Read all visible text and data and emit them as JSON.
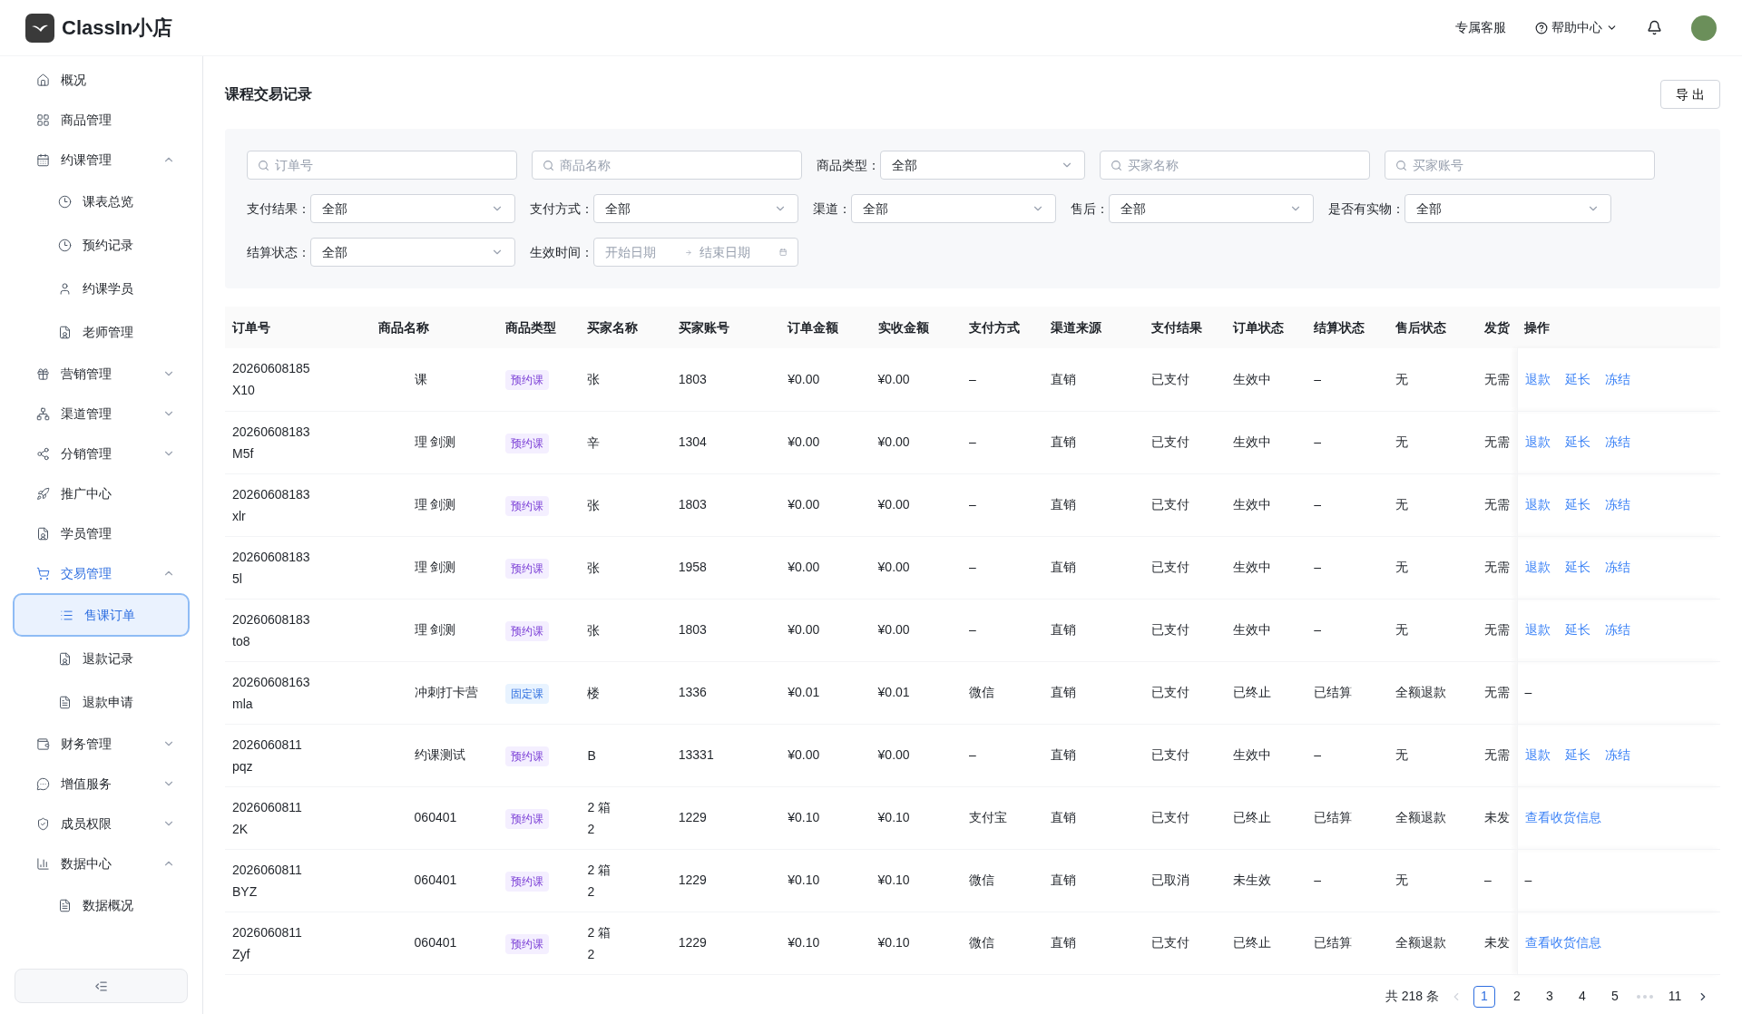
{
  "header": {
    "logo_text": "ClassIn小店",
    "links": [
      "专属客服",
      "帮助中心"
    ]
  },
  "sidebar": {
    "items": [
      {
        "label": "概况"
      },
      {
        "label": "商品管理"
      },
      {
        "label": "约课管理",
        "expanded": true,
        "children": [
          {
            "label": "课表总览",
            "selected": false
          },
          {
            "label": "预约记录",
            "selected": false
          },
          {
            "label": "约课学员",
            "selected": false
          },
          {
            "label": "老师管理",
            "selected": false
          }
        ]
      },
      {
        "label": "营销管理",
        "expanded": false
      },
      {
        "label": "渠道管理",
        "expanded": false
      },
      {
        "label": "分销管理",
        "expanded": false
      },
      {
        "label": "推广中心"
      },
      {
        "label": "学员管理"
      },
      {
        "label": "交易管理",
        "expanded": true,
        "active": true,
        "children": [
          {
            "label": "售课订单",
            "selected": true
          },
          {
            "label": "退款记录",
            "selected": false
          },
          {
            "label": "退款申请",
            "selected": false
          }
        ]
      },
      {
        "label": "财务管理",
        "expanded": false
      },
      {
        "label": "增值服务",
        "expanded": false
      },
      {
        "label": "成员权限",
        "expanded": false
      },
      {
        "label": "数据中心",
        "expanded": true,
        "children": [
          {
            "label": "数据概况",
            "selected": false
          }
        ]
      }
    ]
  },
  "page": {
    "title": "课程交易记录",
    "export_button": "导 出"
  },
  "filters": {
    "search_fields": [
      {
        "placeholder": "订单号"
      },
      {
        "placeholder": "商品名称"
      },
      {
        "placeholder": "买家名称"
      },
      {
        "placeholder": "买家账号"
      }
    ],
    "product_type": {
      "label": "商品类型：",
      "value": "全部"
    },
    "selects": [
      {
        "label": "支付结果：",
        "value": "全部"
      },
      {
        "label": "支付方式：",
        "value": "全部"
      },
      {
        "label": "渠道：",
        "value": "全部"
      },
      {
        "label": "售后：",
        "value": "全部"
      },
      {
        "label": "是否有实物：",
        "value": "全部"
      }
    ],
    "settlement": {
      "label": "结算状态：",
      "value": "全部"
    },
    "date_range": {
      "label": "生效时间：",
      "start_placeholder": "开始日期",
      "end_placeholder": "结束日期"
    }
  },
  "table": {
    "columns": [
      "订单号",
      "商品名称",
      "商品类型",
      "买家名称",
      "买家账号",
      "订单金额",
      "实收金额",
      "支付方式",
      "渠道来源",
      "支付结果",
      "订单状态",
      "结算状态",
      "售后状态",
      "发货",
      "操作"
    ],
    "rows": [
      {
        "order": [
          "20260608185",
          "X10"
        ],
        "product": "课",
        "type": {
          "label": "预约课",
          "kind": "booking"
        },
        "buyer": [
          "张"
        ],
        "account": "1803",
        "amount": "¥0.00",
        "received": "¥0.00",
        "pay_method": "–",
        "channel": "直销",
        "pay_result": "已支付",
        "status": "生效中",
        "settle": "–",
        "after_sale": "无",
        "ship": "无需",
        "actions": [
          "退款",
          "延长",
          "冻结"
        ]
      },
      {
        "order": [
          "20260608183",
          "M5f"
        ],
        "product": "理 剑测",
        "type": {
          "label": "预约课",
          "kind": "booking"
        },
        "buyer": [
          "辛"
        ],
        "account": "1304",
        "amount": "¥0.00",
        "received": "¥0.00",
        "pay_method": "–",
        "channel": "直销",
        "pay_result": "已支付",
        "status": "生效中",
        "settle": "–",
        "after_sale": "无",
        "ship": "无需",
        "actions": [
          "退款",
          "延长",
          "冻结"
        ]
      },
      {
        "order": [
          "20260608183",
          "xlr"
        ],
        "product": "理 剑测",
        "type": {
          "label": "预约课",
          "kind": "booking"
        },
        "buyer": [
          "张"
        ],
        "account": "1803",
        "amount": "¥0.00",
        "received": "¥0.00",
        "pay_method": "–",
        "channel": "直销",
        "pay_result": "已支付",
        "status": "生效中",
        "settle": "–",
        "after_sale": "无",
        "ship": "无需",
        "actions": [
          "退款",
          "延长",
          "冻结"
        ]
      },
      {
        "order": [
          "20260608183",
          "5l"
        ],
        "product": "理 剑测",
        "type": {
          "label": "预约课",
          "kind": "booking"
        },
        "buyer": [
          "张"
        ],
        "account": "1958",
        "amount": "¥0.00",
        "received": "¥0.00",
        "pay_method": "–",
        "channel": "直销",
        "pay_result": "已支付",
        "status": "生效中",
        "settle": "–",
        "after_sale": "无",
        "ship": "无需",
        "actions": [
          "退款",
          "延长",
          "冻结"
        ]
      },
      {
        "order": [
          "20260608183",
          "to8"
        ],
        "product": "理 剑测",
        "type": {
          "label": "预约课",
          "kind": "booking"
        },
        "buyer": [
          "张"
        ],
        "account": "1803",
        "amount": "¥0.00",
        "received": "¥0.00",
        "pay_method": "–",
        "channel": "直销",
        "pay_result": "已支付",
        "status": "生效中",
        "settle": "–",
        "after_sale": "无",
        "ship": "无需",
        "actions": [
          "退款",
          "延长",
          "冻结"
        ]
      },
      {
        "order": [
          "20260608163",
          "mla"
        ],
        "product": "冲刺打卡营",
        "type": {
          "label": "固定课",
          "kind": "fixed"
        },
        "buyer": [
          "楼"
        ],
        "account": "1336",
        "amount": "¥0.01",
        "received": "¥0.01",
        "pay_method": "微信",
        "channel": "直销",
        "pay_result": "已支付",
        "status": "已终止",
        "settle": "已结算",
        "after_sale": "全额退款",
        "ship": "无需",
        "actions": [
          "–"
        ]
      },
      {
        "order": [
          "2026060811",
          "pqz"
        ],
        "product": "约课测试",
        "type": {
          "label": "预约课",
          "kind": "booking"
        },
        "buyer": [
          "B"
        ],
        "account": "13331",
        "amount": "¥0.00",
        "received": "¥0.00",
        "pay_method": "–",
        "channel": "直销",
        "pay_result": "已支付",
        "status": "生效中",
        "settle": "–",
        "after_sale": "无",
        "ship": "无需",
        "actions": [
          "退款",
          "延长",
          "冻结"
        ]
      },
      {
        "order": [
          "2026060811",
          "2K"
        ],
        "product": "060401",
        "type": {
          "label": "预约课",
          "kind": "booking"
        },
        "buyer": [
          "2 箱",
          "2"
        ],
        "account": "1229",
        "amount": "¥0.10",
        "received": "¥0.10",
        "pay_method": "支付宝",
        "channel": "直销",
        "pay_result": "已支付",
        "status": "已终止",
        "settle": "已结算",
        "after_sale": "全额退款",
        "ship": "未发",
        "actions": [
          "查看收货信息"
        ]
      },
      {
        "order": [
          "2026060811",
          "BYZ"
        ],
        "product": "060401",
        "type": {
          "label": "预约课",
          "kind": "booking"
        },
        "buyer": [
          "2 箱",
          "2"
        ],
        "account": "1229",
        "amount": "¥0.10",
        "received": "¥0.10",
        "pay_method": "微信",
        "channel": "直销",
        "pay_result": "已取消",
        "status": "未生效",
        "settle": "–",
        "after_sale": "无",
        "ship": "–",
        "actions": [
          "–"
        ]
      },
      {
        "order": [
          "2026060811",
          "Zyf"
        ],
        "product": "060401",
        "type": {
          "label": "预约课",
          "kind": "booking"
        },
        "buyer": [
          "2 箱",
          "2"
        ],
        "account": "1229",
        "amount": "¥0.10",
        "received": "¥0.10",
        "pay_method": "微信",
        "channel": "直销",
        "pay_result": "已支付",
        "status": "已终止",
        "settle": "已结算",
        "after_sale": "全额退款",
        "ship": "未发",
        "actions": [
          "查看收货信息"
        ]
      }
    ]
  },
  "pagination": {
    "total": "共 218 条",
    "pages": [
      {
        "label": "1",
        "selected": true
      },
      {
        "label": "2",
        "selected": false
      },
      {
        "label": "3",
        "selected": false
      },
      {
        "label": "4",
        "selected": false
      },
      {
        "label": "5",
        "selected": false
      },
      {
        "label": "11",
        "selected": false
      }
    ]
  }
}
